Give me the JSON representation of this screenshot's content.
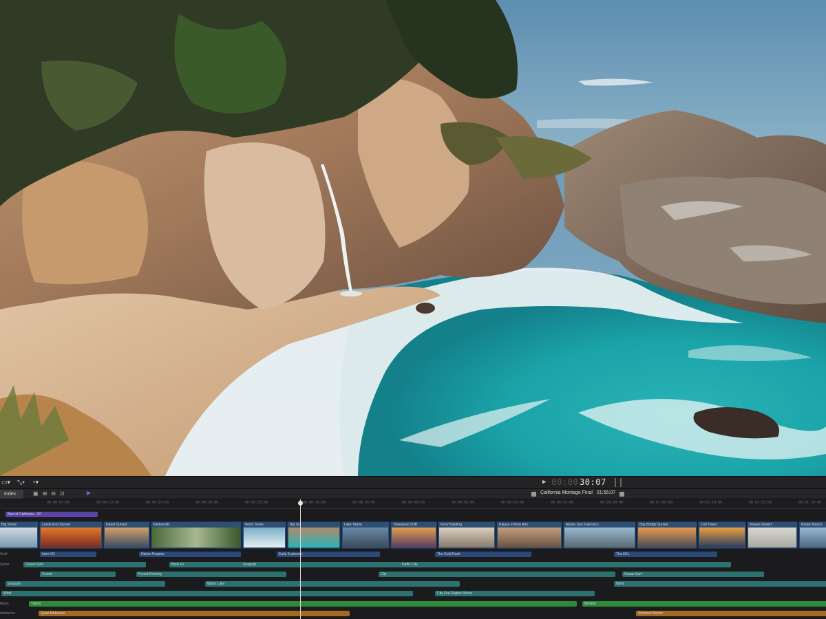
{
  "toolbar": {
    "timecode_dim": "00:00",
    "timecode_bright": "30:07",
    "play_icon": "play-icon"
  },
  "timeline_bar": {
    "index_label": "Index",
    "project_name": "California Montage Final",
    "project_duration": "01:55:07"
  },
  "ruler": {
    "ticks": [
      "00:00:05:00",
      "00:00:10:00",
      "00:00:15:00",
      "00:00:20:00",
      "00:00:25:00",
      "00:00:30:00",
      "00:00:35:00",
      "00:00:40:00",
      "00:00:45:00",
      "00:00:50:00",
      "00:00:55:00",
      "00:01:00:00",
      "00:01:05:00",
      "00:01:10:00",
      "00:01:15:00",
      "00:01:20:00"
    ]
  },
  "marker": {
    "label": "Best of California - 3D"
  },
  "video_clips": [
    {
      "label": "Big Shore"
    },
    {
      "label": "Lands End Sunset"
    },
    {
      "label": "Island Sunset"
    },
    {
      "label": "Redwoods"
    },
    {
      "label": "North Shore"
    },
    {
      "label": "Big Sur"
    },
    {
      "label": "Lake Tahoe"
    },
    {
      "label": "Timelapse DOB"
    },
    {
      "label": "Ferry Building"
    },
    {
      "label": "Palace of Fine Arts"
    },
    {
      "label": "Above San Francisco"
    },
    {
      "label": "Bay Bridge Sunset"
    },
    {
      "label": "Coit Tower"
    },
    {
      "label": "Mojave Desert"
    },
    {
      "label": "Rodeo Beach"
    }
  ],
  "row_labels": [
    "Gold",
    "Surfer",
    "Music",
    "Ambience"
  ],
  "audio_row1": [
    "Intro VO",
    "Native Peoples",
    "Early Explorers",
    "The Gold Rush",
    "The 60's"
  ],
  "audio_row2": [
    "Ocean Surf",
    "Birds Fx",
    "Seagulls",
    "Traffic City"
  ],
  "audio_row3": [
    "Crowd",
    "Forest Evening",
    "City",
    "Ocean Surf"
  ],
  "audio_row4": [
    "Seagulls",
    "Water Lake",
    "Wind"
  ],
  "audio_row5": [
    "Wind",
    "City Fire Engine Sirens"
  ],
  "music_row": [
    "Travel",
    "Modern"
  ],
  "ambience_row": [
    "Quiet Ambience",
    "Shimmer Motion"
  ]
}
